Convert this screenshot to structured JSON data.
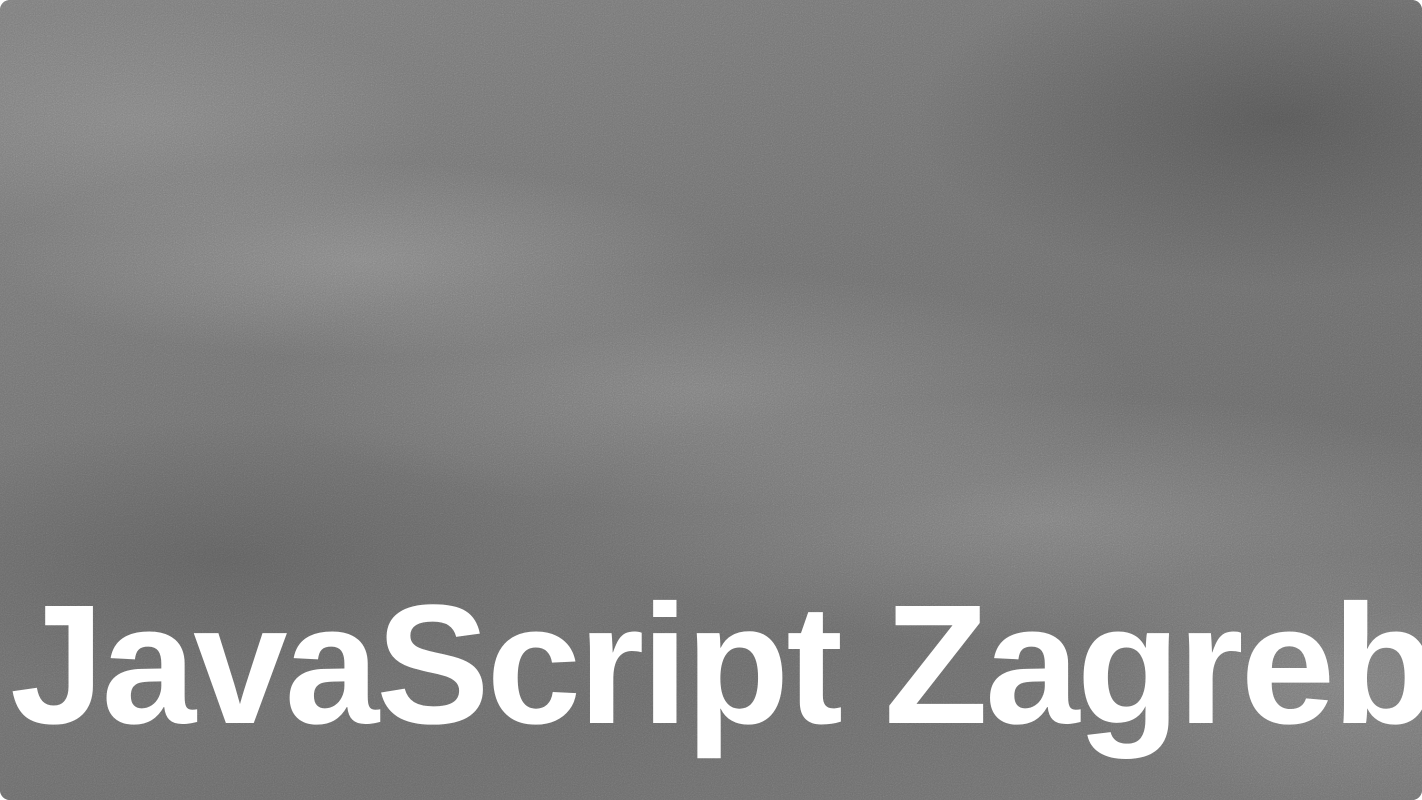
{
  "slide": {
    "title": "JavaScript Zagreb"
  },
  "colors": {
    "background": "#6e6e6e",
    "title_text": "#ffffff"
  }
}
